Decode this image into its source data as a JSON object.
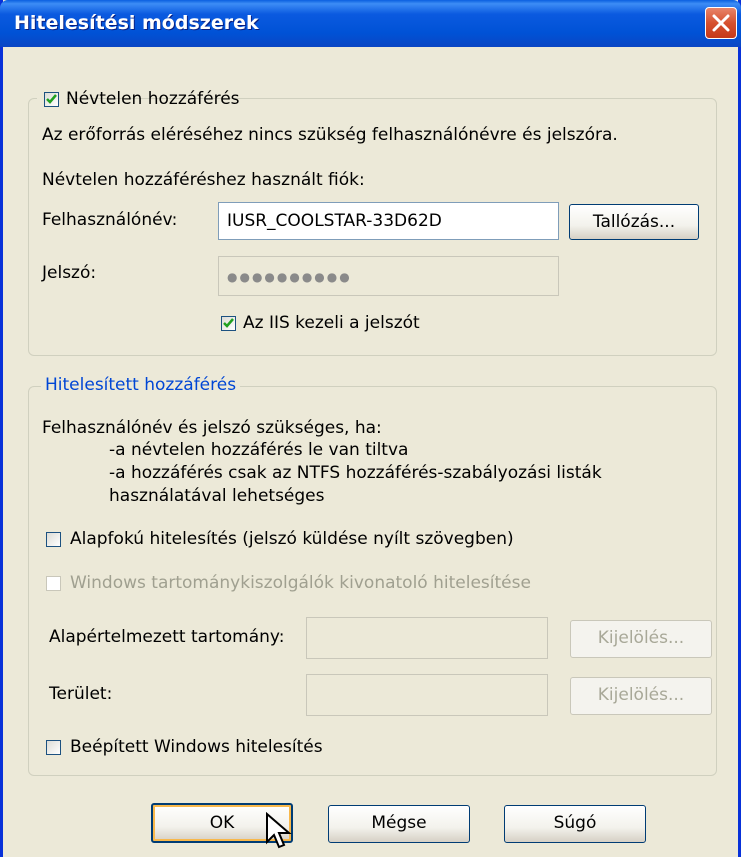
{
  "window": {
    "title": "Hitelesítési módszerek"
  },
  "anonymous": {
    "checkbox_label": "Névtelen hozzáférés",
    "checked": true,
    "description": "Az erőforrás eléréséhez nincs szükség felhasználónévre és jelszóra.",
    "account_label": "Névtelen hozzáféréshez használt fiók:",
    "username_label": "Felhasználónév:",
    "username_value": "IUSR_COOLSTAR-33D62D",
    "browse_button": "Tallózás...",
    "password_label": "Jelszó:",
    "password_value": "●●●●●●●●●●",
    "iis_password_label": "Az IIS kezeli a jelszót",
    "iis_password_checked": true
  },
  "authenticated": {
    "legend": "Hitelesített hozzáférés",
    "intro": "Felhasználónév és jelszó szükséges, ha:",
    "bullet1": "-a névtelen hozzáférés le van tiltva",
    "bullet2": "-a hozzáférés csak az NTFS hozzáférés-szabályozási listák",
    "bullet2_cont": "használatával lehetséges",
    "basic_auth_label": "Alapfokú hitelesítés (jelszó küldése nyílt szövegben)",
    "digest_auth_label": "Windows tartománykiszolgálók kivonatoló hitelesítése",
    "default_domain_label": "Alapértelmezett tartomány:",
    "select_button_1": "Kijelölés...",
    "realm_label": "Terület:",
    "select_button_2": "Kijelölés...",
    "integrated_auth_label": "Beépített Windows hitelesítés"
  },
  "footer": {
    "ok": "OK",
    "cancel": "Mégse",
    "help": "Súgó"
  }
}
